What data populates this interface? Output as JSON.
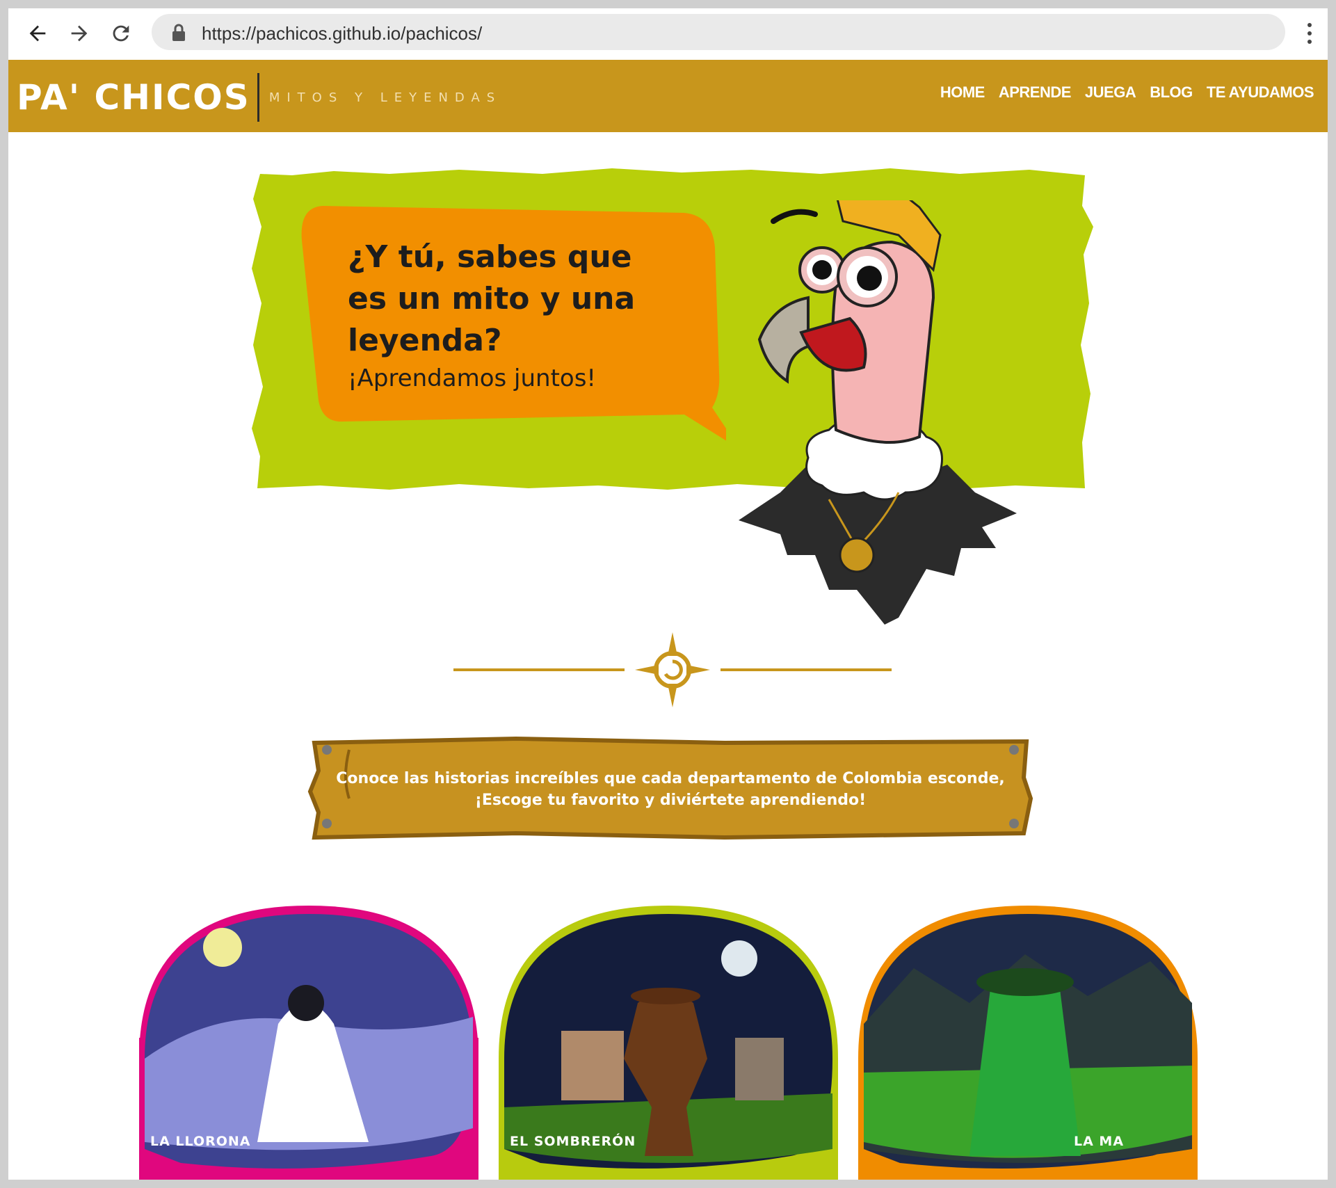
{
  "browser": {
    "url": "https://pachicos.github.io/pachicos/"
  },
  "site": {
    "logo": "PA' CHICOS",
    "tagline": "MITOS Y LEYENDAS",
    "nav": [
      {
        "label": "HOME"
      },
      {
        "label": "APRENDE"
      },
      {
        "label": "JUEGA"
      },
      {
        "label": "BLOG"
      },
      {
        "label": "TE AYUDAMOS"
      }
    ]
  },
  "hero": {
    "title": "¿Y tú, sabes que es un mito y una leyenda?",
    "subtitle": "¡Aprendamos juntos!"
  },
  "sign": {
    "line1": "Conoce las historias increíbles que cada departamento de Colombia esconde,",
    "line2": "¡Escoge tu favorito y diviértete aprendiendo!"
  },
  "cards": [
    {
      "label": "LA LLORONA",
      "color": "#e0077e"
    },
    {
      "label": "EL SOMBRERÓN",
      "color": "#b8cb0e"
    },
    {
      "label": "LA MA",
      "color": "#f08c00"
    }
  ],
  "colors": {
    "header": "#c8961c",
    "hero_green": "#b8cf0a",
    "bubble_orange": "#f28f00",
    "wood": "#c79220"
  }
}
